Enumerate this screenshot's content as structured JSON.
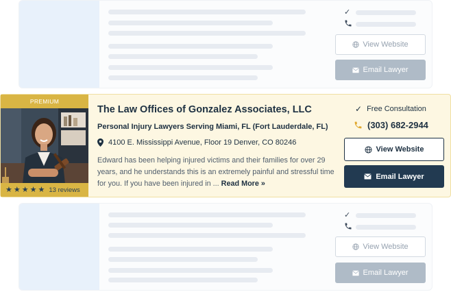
{
  "placeholder_cards": [
    {
      "view_website_label": "View Website",
      "email_lawyer_label": "Email Lawyer"
    },
    {
      "view_website_label": "View Website",
      "email_lawyer_label": "Email Lawyer"
    }
  ],
  "listing": {
    "badge": "PREMIUM",
    "title": "The Law Offices of Gonzalez Associates, LLC",
    "subtitle": "Personal Injury Lawyers Serving Miami, FL (Fort Lauderdale, FL)",
    "address": "4100 E. Mississippi Avenue, Floor 19 Denver, CO 80246",
    "description": "Edward has been helping injured victims and their families for over 29 years, and he understands this is an extremely painful and stressful time for you. If you have been injured in ...",
    "read_more": "Read More »",
    "rating_stars": 5,
    "reviews_text": "13 reviews",
    "consultation": "Free Consultation",
    "phone": "(303) 682-2944",
    "view_website_label": "View Website",
    "email_lawyer_label": "Email Lawyer"
  },
  "icons": {
    "check": "check-icon",
    "phone": "phone-icon",
    "pin": "map-pin-icon",
    "globe": "globe-icon",
    "mail": "mail-icon",
    "star": "star-icon"
  },
  "colors": {
    "premium_gold": "#d9b544",
    "navy": "#223a51",
    "card_bg": "#fdf7e2",
    "phone_icon": "#e0a82e"
  }
}
